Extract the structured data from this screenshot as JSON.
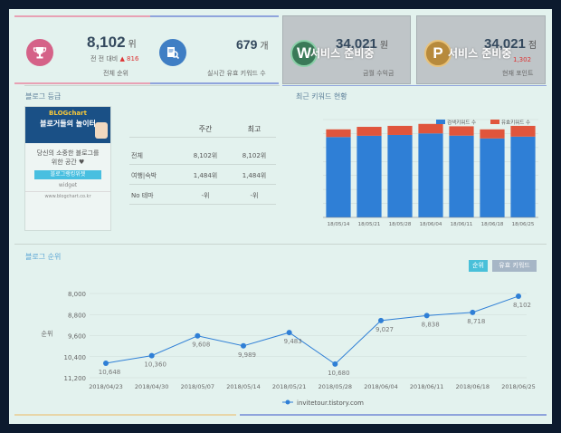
{
  "stats": {
    "rank": {
      "value": "8,102",
      "unit": "위",
      "change_label": "전 전 대비",
      "change_value": "▲ 816",
      "label": "전체 순위"
    },
    "keywords": {
      "value": "679",
      "unit": "개",
      "label": "실시간 유효 키워드 수"
    },
    "revenue": {
      "value": "34,021",
      "unit": "원",
      "label": "금월 수익금",
      "overlay": "서비스 준비중",
      "coin": "W"
    },
    "points": {
      "value": "34,021",
      "unit": "점",
      "label": "현재 포인트",
      "overlay": "서비스 준비중",
      "coin": "P",
      "note": "1,302"
    }
  },
  "blog_grade": {
    "title": "블로그 등급",
    "widget": {
      "brand": "BLOGchart",
      "slogan": "블로거들의 놀이터",
      "desc_line1": "당신의 소중한 블로그를",
      "desc_line2": "위한 공간 ♥",
      "button": "블로그랭킹위젯",
      "label": "widget",
      "url": "www.blogchart.co.kr"
    },
    "table": {
      "headers": [
        "",
        "주간",
        "최고"
      ],
      "rows": [
        [
          "전체",
          "8,102위",
          "8,102위"
        ],
        [
          "여행|숙박",
          "1,484위",
          "1,484위"
        ],
        [
          "No 테마",
          "-위",
          "-위"
        ]
      ]
    }
  },
  "keyword_chart": {
    "title": "최근 키워드 현황"
  },
  "chart_data": [
    {
      "type": "bar",
      "title": "최근 키워드 현황",
      "categories": [
        "18/05/14",
        "18/05/21",
        "18/05/28",
        "18/06/04",
        "18/06/11",
        "18/06/18",
        "18/06/25"
      ],
      "series": [
        {
          "name": "검색키워드 수",
          "values": [
            5750,
            5840,
            5900,
            6010,
            5850,
            5650,
            5780
          ],
          "color": "#2f7fd6"
        },
        {
          "name": "유효키워드 수",
          "values": [
            550,
            640,
            650,
            680,
            670,
            650,
            770
          ],
          "color": "#e0553c"
        }
      ],
      "stacked": true,
      "ylim": [
        0,
        7000
      ],
      "yticks": [
        0,
        1000,
        2000,
        3000,
        4000,
        5000,
        6000,
        7000
      ],
      "legend": "top-right",
      "grid": true
    },
    {
      "type": "line",
      "title": "블로그 순위",
      "x": [
        "2018/04/23",
        "2018/04/30",
        "2018/05/07",
        "2018/05/14",
        "2018/05/21",
        "2018/05/28",
        "2018/06/04",
        "2018/06/11",
        "2018/06/18",
        "2018/06/25"
      ],
      "series": [
        {
          "name": "invitetour.tistory.com",
          "values": [
            10648,
            10360,
            9608,
            9989,
            9483,
            10680,
            9027,
            8838,
            8718,
            8102
          ],
          "color": "#2f7fd6"
        }
      ],
      "ylabel": "순위",
      "yticks": [
        "8,000",
        "8,800",
        "9,600",
        "10,400",
        "11,200"
      ],
      "y_reversed": true,
      "ylim": [
        8000,
        11200
      ],
      "grid": true,
      "legend": "bottom-center",
      "tabs": [
        "순위",
        "유효 키워드"
      ]
    }
  ]
}
